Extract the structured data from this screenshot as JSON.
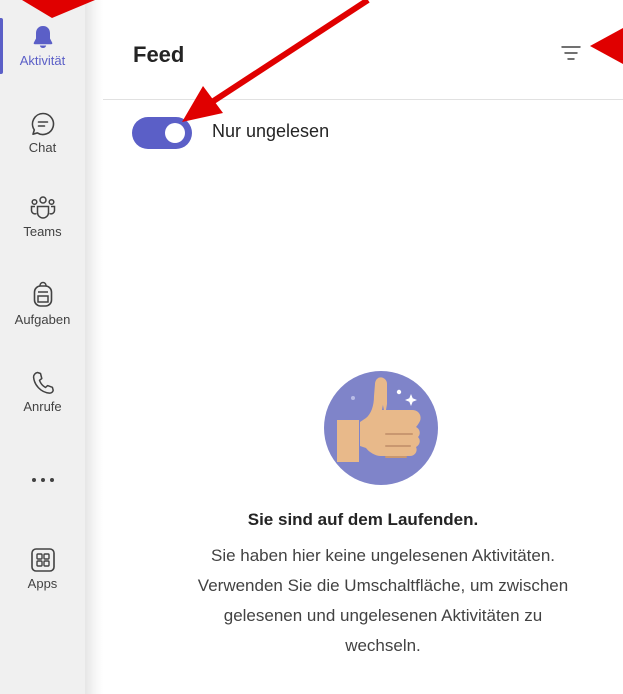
{
  "rail": {
    "items": [
      {
        "label": "Aktivität",
        "icon": "bell-icon"
      },
      {
        "label": "Chat",
        "icon": "chat-icon"
      },
      {
        "label": "Teams",
        "icon": "teams-icon"
      },
      {
        "label": "Aufgaben",
        "icon": "backpack-icon"
      },
      {
        "label": "Anrufe",
        "icon": "phone-icon"
      },
      {
        "label": "Apps",
        "icon": "apps-icon"
      }
    ],
    "more_label": "···"
  },
  "header": {
    "title": "Feed",
    "filter_icon": "filter-icon"
  },
  "toggle": {
    "label": "Nur ungelesen",
    "state": "on"
  },
  "empty_state": {
    "title": "Sie sind auf dem Laufenden.",
    "lines": [
      "Sie haben hier keine ungelesenen Aktivitäten.",
      "Verwenden Sie die Umschaltfläche, um zwischen",
      "gelesenen und ungelesenen Aktivitäten zu",
      "wechseln."
    ]
  },
  "colors": {
    "accent": "#5b5fc7",
    "annotation": "#e00000"
  }
}
